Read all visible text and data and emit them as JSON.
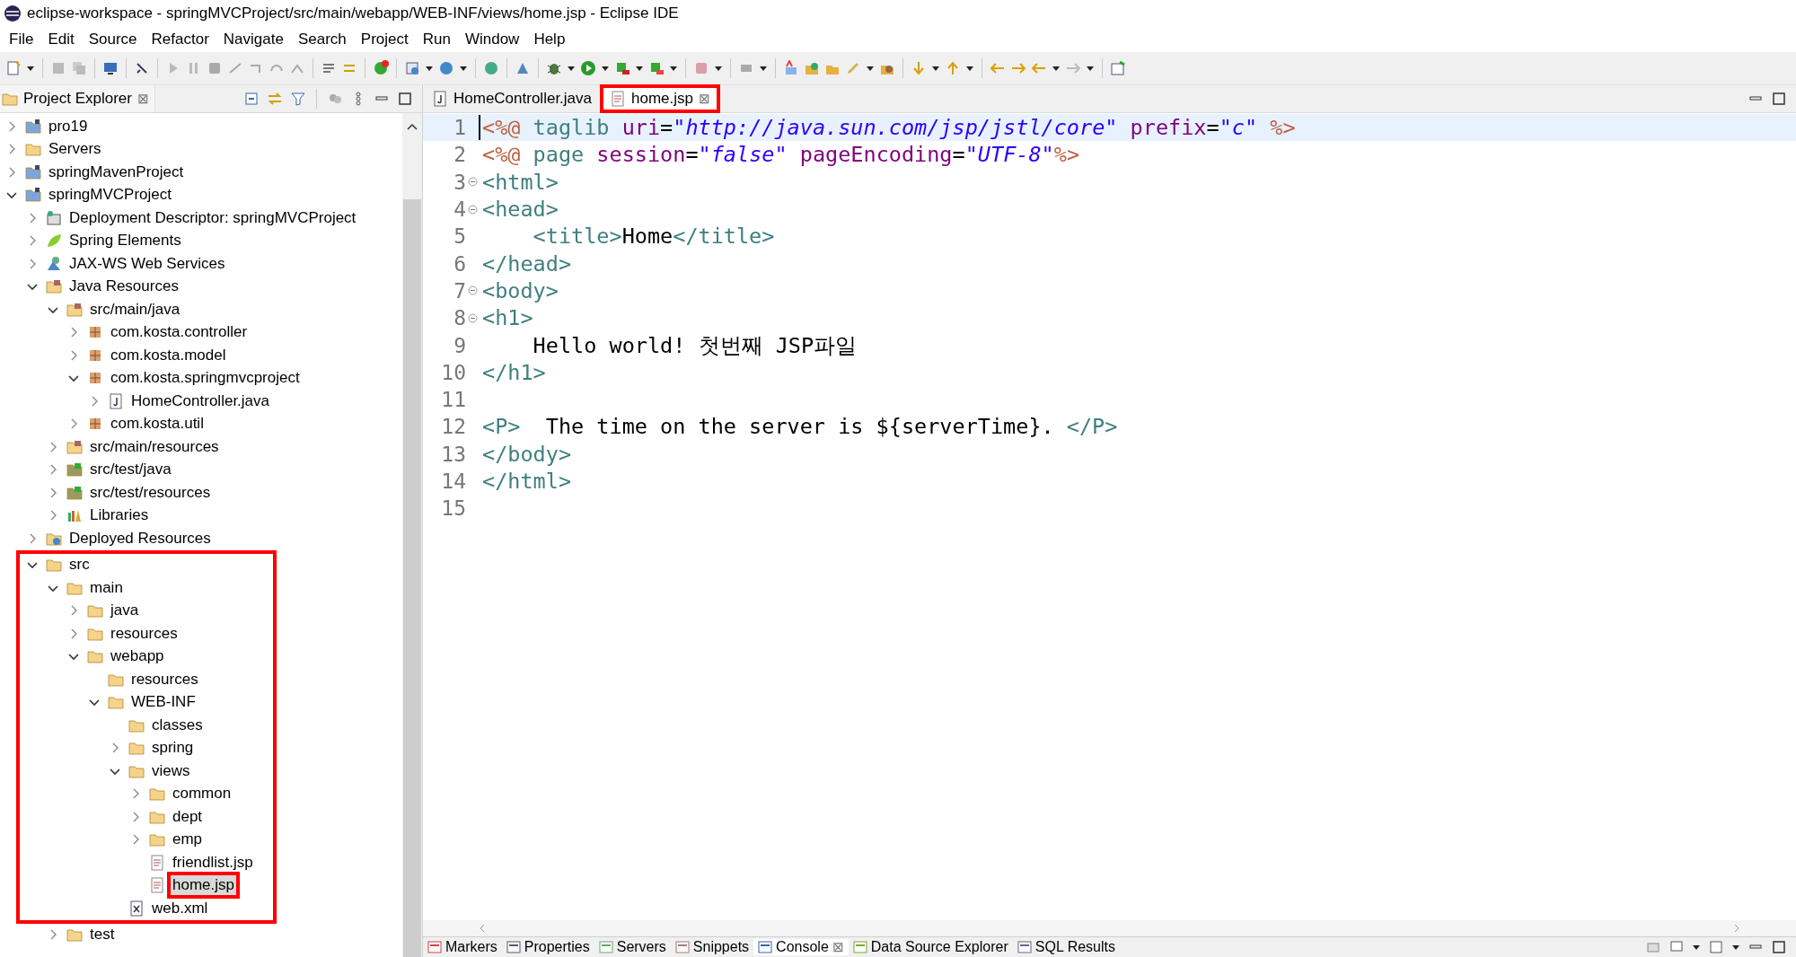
{
  "window": {
    "title": "eclipse-workspace - springMVCProject/src/main/webapp/WEB-INF/views/home.jsp - Eclipse IDE"
  },
  "menu": [
    "File",
    "Edit",
    "Source",
    "Refactor",
    "Navigate",
    "Search",
    "Project",
    "Run",
    "Window",
    "Help"
  ],
  "explorer": {
    "title": "Project Explorer",
    "close": "⊠",
    "tree": [
      {
        "label": "pro19",
        "kind": "project",
        "expanded": false,
        "selected": false
      },
      {
        "label": "Servers",
        "kind": "folder",
        "expanded": false,
        "selected": false
      },
      {
        "label": "springMavenProject",
        "kind": "project",
        "expanded": false,
        "selected": false
      },
      {
        "label": "springMVCProject",
        "kind": "project",
        "expanded": true,
        "selected": false,
        "children": [
          {
            "label": "Deployment Descriptor: springMVCProject",
            "kind": "descriptor",
            "expanded": false,
            "selected": false
          },
          {
            "label": "Spring Elements",
            "kind": "spring",
            "expanded": false,
            "selected": false
          },
          {
            "label": "JAX-WS Web Services",
            "kind": "webservice",
            "expanded": false,
            "selected": false
          },
          {
            "label": "Java Resources",
            "kind": "source",
            "expanded": true,
            "selected": false,
            "children": [
              {
                "label": "src/main/java",
                "kind": "source",
                "expanded": true,
                "selected": false,
                "children": [
                  {
                    "label": "com.kosta.controller",
                    "kind": "package",
                    "expanded": false,
                    "selected": false
                  },
                  {
                    "label": "com.kosta.model",
                    "kind": "package",
                    "expanded": false,
                    "selected": false
                  },
                  {
                    "label": "com.kosta.springmvcproject",
                    "kind": "package",
                    "expanded": true,
                    "selected": false,
                    "children": [
                      {
                        "label": "HomeController.java",
                        "kind": "java",
                        "expanded": false,
                        "selected": false
                      }
                    ]
                  },
                  {
                    "label": "com.kosta.util",
                    "kind": "package",
                    "expanded": false,
                    "selected": false
                  }
                ]
              },
              {
                "label": "src/main/resources",
                "kind": "source",
                "expanded": false,
                "selected": false
              },
              {
                "label": "src/test/java",
                "kind": "testsource",
                "expanded": false,
                "selected": false
              },
              {
                "label": "src/test/resources",
                "kind": "testsource",
                "expanded": false,
                "selected": false
              },
              {
                "label": "Libraries",
                "kind": "library",
                "expanded": false,
                "selected": false
              }
            ]
          },
          {
            "label": "Deployed Resources",
            "kind": "deployed",
            "expanded": false,
            "selected": false
          },
          {
            "label": "src",
            "kind": "folder",
            "expanded": true,
            "selected": false,
            "framed": true,
            "children": [
              {
                "label": "main",
                "kind": "folder",
                "expanded": true,
                "selected": false,
                "framed": true,
                "children": [
                  {
                    "label": "java",
                    "kind": "folder",
                    "expanded": false,
                    "selected": false,
                    "framed": true
                  },
                  {
                    "label": "resources",
                    "kind": "folder",
                    "expanded": false,
                    "selected": false,
                    "framed": true
                  },
                  {
                    "label": "webapp",
                    "kind": "folder",
                    "expanded": true,
                    "selected": false,
                    "framed": true,
                    "children": [
                      {
                        "label": "resources",
                        "kind": "folder",
                        "selected": false,
                        "framed": true
                      },
                      {
                        "label": "WEB-INF",
                        "kind": "folder",
                        "expanded": true,
                        "selected": false,
                        "framed": true,
                        "children": [
                          {
                            "label": "classes",
                            "kind": "folder",
                            "selected": false,
                            "framed": true
                          },
                          {
                            "label": "spring",
                            "kind": "folder",
                            "expanded": false,
                            "selected": false,
                            "framed": true
                          },
                          {
                            "label": "views",
                            "kind": "folder",
                            "expanded": true,
                            "selected": false,
                            "framed": true,
                            "children": [
                              {
                                "label": "common",
                                "kind": "folder",
                                "expanded": false,
                                "selected": false,
                                "framed": true
                              },
                              {
                                "label": "dept",
                                "kind": "folder",
                                "expanded": false,
                                "selected": false,
                                "framed": true
                              },
                              {
                                "label": "emp",
                                "kind": "folder",
                                "expanded": false,
                                "selected": false,
                                "framed": true
                              },
                              {
                                "label": "friendlist.jsp",
                                "kind": "jsp",
                                "selected": false,
                                "framed": true
                              },
                              {
                                "label": "home.jsp",
                                "kind": "jsp",
                                "selected": true,
                                "framed": true,
                                "annotated": true
                              }
                            ]
                          },
                          {
                            "label": "web.xml",
                            "kind": "xml",
                            "selected": false,
                            "framed": true
                          }
                        ]
                      }
                    ]
                  }
                ]
              },
              {
                "label": "test",
                "kind": "folder",
                "expanded": false,
                "selected": false
              }
            ]
          }
        ]
      }
    ]
  },
  "editor": {
    "tabs": [
      {
        "label": "HomeController.java",
        "kind": "java",
        "selected": false
      },
      {
        "label": "home.jsp",
        "kind": "jsp",
        "selected": true,
        "annotated": true,
        "close": "⊠"
      }
    ],
    "lines": [
      {
        "number": "1",
        "current": true,
        "foldable": false,
        "tokens": [
          {
            "kind": "directive",
            "text": "<%@"
          },
          {
            "kind": "keyword",
            "text": " taglib "
          },
          {
            "kind": "attr",
            "text": "uri"
          },
          {
            "kind": "text",
            "text": "="
          },
          {
            "kind": "string",
            "text": "\"http://java.sun.com/jsp/jstl/core\""
          },
          {
            "kind": "attr",
            "text": " prefix"
          },
          {
            "kind": "text",
            "text": "="
          },
          {
            "kind": "string",
            "text": "\"c\""
          },
          {
            "kind": "directive",
            "text": " %>"
          }
        ]
      },
      {
        "number": "2",
        "current": false,
        "foldable": false,
        "tokens": [
          {
            "kind": "directive",
            "text": "<%@"
          },
          {
            "kind": "keyword",
            "text": " page "
          },
          {
            "kind": "attr",
            "text": "session"
          },
          {
            "kind": "text",
            "text": "="
          },
          {
            "kind": "string",
            "text": "\"false\""
          },
          {
            "kind": "attr",
            "text": " pageEncoding"
          },
          {
            "kind": "text",
            "text": "="
          },
          {
            "kind": "string",
            "text": "\"UTF-8\""
          },
          {
            "kind": "directive",
            "text": "%>"
          }
        ]
      },
      {
        "number": "3",
        "current": false,
        "foldable": true,
        "tokens": [
          {
            "kind": "tag",
            "text": "<html>"
          }
        ]
      },
      {
        "number": "4",
        "current": false,
        "foldable": true,
        "tokens": [
          {
            "kind": "tag",
            "text": "<head>"
          }
        ]
      },
      {
        "number": "5",
        "current": false,
        "foldable": false,
        "indented": true,
        "tokens": [
          {
            "kind": "tag",
            "text": "<title>"
          },
          {
            "kind": "text",
            "text": "Home"
          },
          {
            "kind": "tag",
            "text": "</title>"
          }
        ]
      },
      {
        "number": "6",
        "current": false,
        "foldable": false,
        "tokens": [
          {
            "kind": "tag",
            "text": "</head>"
          }
        ]
      },
      {
        "number": "7",
        "current": false,
        "foldable": true,
        "tokens": [
          {
            "kind": "tag",
            "text": "<body>"
          }
        ]
      },
      {
        "number": "8",
        "current": false,
        "foldable": true,
        "tokens": [
          {
            "kind": "tag",
            "text": "<h1>"
          }
        ]
      },
      {
        "number": "9",
        "current": false,
        "foldable": false,
        "tokens": [
          {
            "kind": "text",
            "text": "    Hello world! 첫번째 JSP파일"
          }
        ]
      },
      {
        "number": "10",
        "current": false,
        "foldable": false,
        "tokens": [
          {
            "kind": "tag",
            "text": "</h1>"
          }
        ]
      },
      {
        "number": "11",
        "current": false,
        "foldable": false
      },
      {
        "number": "12",
        "current": false,
        "foldable": false,
        "tokens": [
          {
            "kind": "tag",
            "text": "<P>"
          },
          {
            "kind": "text",
            "text": "  The time on the server is ${serverTime}. "
          },
          {
            "kind": "tag",
            "text": "</P>"
          }
        ]
      },
      {
        "number": "13",
        "current": false,
        "foldable": false,
        "tokens": [
          {
            "kind": "tag",
            "text": "</body>"
          }
        ]
      },
      {
        "number": "14",
        "current": false,
        "foldable": false,
        "tokens": [
          {
            "kind": "tag",
            "text": "</html>"
          }
        ]
      },
      {
        "number": "15",
        "current": false,
        "foldable": false
      }
    ]
  },
  "bottom_panel": {
    "tabs": [
      {
        "label": "Markers",
        "selected": false
      },
      {
        "label": "Properties",
        "selected": false
      },
      {
        "label": "Servers",
        "selected": false
      },
      {
        "label": "Snippets",
        "selected": false
      },
      {
        "label": "Console",
        "selected": true,
        "close": "⊠"
      },
      {
        "label": "Data Source Explorer",
        "selected": false
      },
      {
        "label": "SQL Results",
        "selected": false
      }
    ]
  }
}
